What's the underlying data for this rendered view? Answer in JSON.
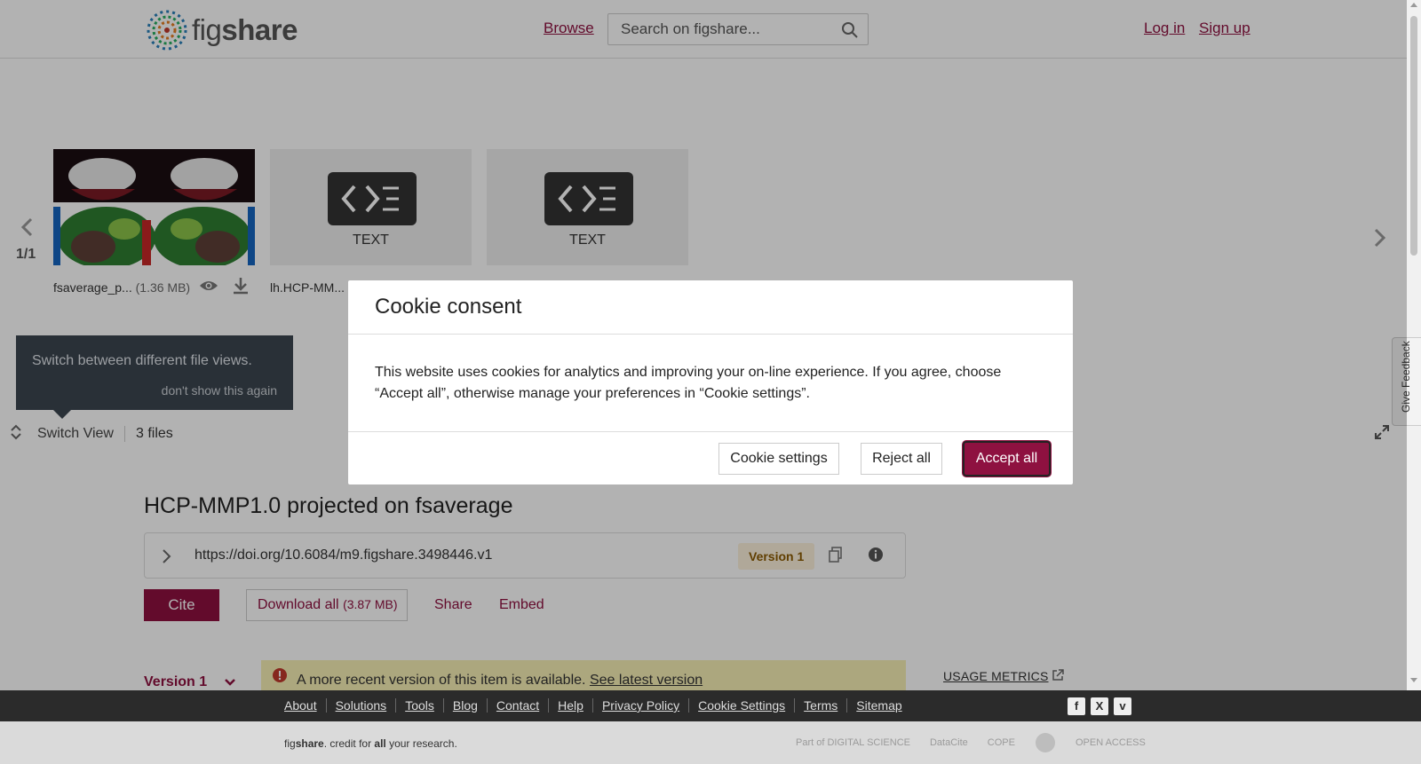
{
  "header": {
    "logo_light": "fig",
    "logo_bold": "share",
    "browse_label": "Browse",
    "search_placeholder": "Search on figshare...",
    "login_label": "Log in",
    "signup_label": "Sign up"
  },
  "viewer": {
    "page_count": "1/1",
    "thumbnails": [
      {
        "type": "image",
        "caption": "fsaverage_p...",
        "size": "(1.36 MB)"
      },
      {
        "type": "text",
        "label": "TEXT",
        "caption": "lh.HCP-MM..."
      },
      {
        "type": "text",
        "label": "TEXT"
      }
    ],
    "tooltip_text": "Switch between different file views.",
    "tooltip_dismiss": "don't show this again",
    "switch_view_label": "Switch View",
    "files_count": "3 files",
    "feedback_label": "Give Feedback"
  },
  "item": {
    "title": "HCP-MMP1.0 projected on fsaverage",
    "doi": "https://doi.org/10.6084/m9.figshare.3498446.v1",
    "version_badge": "Version 1",
    "cite_label": "Cite",
    "download_label": "Download all",
    "download_size": "(3.87 MB)",
    "share_label": "Share",
    "embed_label": "Embed",
    "version_select": "Version 1",
    "notice_text": "A more recent version of this item is available.",
    "notice_link": "See latest version",
    "usage_metrics": "USAGE METRICS"
  },
  "cookie_modal": {
    "title": "Cookie consent",
    "body": "This website uses cookies for analytics and improving your on-line experience. If you agree, choose “Accept all”, otherwise manage your preferences in “Cookie settings”.",
    "settings_label": "Cookie settings",
    "reject_label": "Reject all",
    "accept_label": "Accept all"
  },
  "footer": {
    "links": [
      "About",
      "Solutions",
      "Tools",
      "Blog",
      "Contact",
      "Help",
      "Privacy Policy",
      "Cookie Settings",
      "Terms",
      "Sitemap"
    ],
    "social": [
      "facebook-icon",
      "x-icon",
      "vimeo-icon"
    ],
    "tagline_brand_light": "fig",
    "tagline_brand_bold": "share",
    "tagline_rest": ". credit for ",
    "tagline_all": "all",
    "tagline_end": " your research.",
    "partners": [
      "Part of DIGITAL SCIENCE",
      "DataCite",
      "COPE",
      "",
      "OPEN ACCESS"
    ]
  },
  "colors": {
    "brand": "#8e1140",
    "footer_dark": "#2b2b2b",
    "notice_bg": "#f7efb5"
  }
}
